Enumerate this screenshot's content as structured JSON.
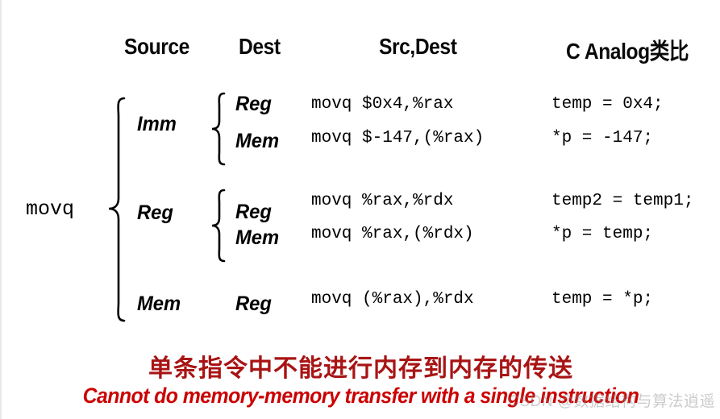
{
  "headers": {
    "source": "Source",
    "dest": "Dest",
    "src_dest": "Src,Dest",
    "c_analog": "C Analog类比"
  },
  "mnemonic": "movq",
  "groups": [
    {
      "source": "Imm"
    },
    {
      "source": "Reg"
    },
    {
      "source": "Mem"
    }
  ],
  "rows": [
    {
      "source": "Imm",
      "dest": "Reg",
      "asm": "movq $0x4,%rax",
      "analog": "temp = 0x4;"
    },
    {
      "source": "Imm",
      "dest": "Mem",
      "asm": "movq $-147,(%rax)",
      "analog": "*p = -147;"
    },
    {
      "source": "Reg",
      "dest": "Reg",
      "asm": "movq %rax,%rdx",
      "analog": "temp2 = temp1;"
    },
    {
      "source": "Reg",
      "dest": "Mem",
      "asm": "movq %rax,(%rdx)",
      "analog": "*p = temp;"
    },
    {
      "source": "Mem",
      "dest": "Reg",
      "asm": "movq (%rax),%rdx",
      "analog": "temp = *p;"
    }
  ],
  "notes": {
    "chinese": "单条指令中不能进行内存到内存的传送",
    "english": "Cannot do memory-memory transfer with a single instruction"
  },
  "watermark": "CSDN @数据结构与算法逍遥",
  "colors": {
    "note_chinese": "#a81414",
    "note_english": "#cc0000",
    "text": "#000000",
    "background": "#ffffff"
  }
}
